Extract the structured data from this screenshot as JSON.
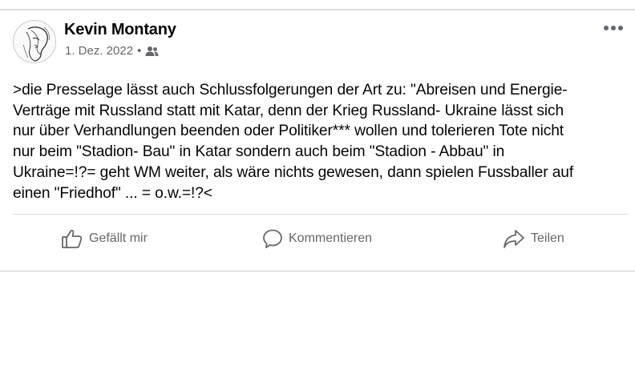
{
  "post": {
    "author": "Kevin Montany",
    "date": "1. Dez. 2022",
    "separator": "•",
    "audience_icon": "friends-icon",
    "body": ">die Presselage lässt auch Schlussfolgerungen der Art zu: \"Abreisen und Energie-\nVerträge mit Russland statt mit Katar, denn der Krieg Russland- Ukraine lässt sich\nnur über Verhandlungen beenden oder Politiker*** wollen und tolerieren Tote nicht\nnur beim \"Stadion- Bau\" in Katar sondern auch beim \"Stadion - Abbau\" in\nUkraine=!?= geht WM weiter, als wäre nichts gewesen, dann spielen Fussballer auf\neinen \"Friedhof\" ... = o.w.=!?<"
  },
  "actions": {
    "like_label": "Gefällt mir",
    "comment_label": "Kommentieren",
    "share_label": "Teilen"
  },
  "colors": {
    "text": "#050505",
    "secondary": "#65676b",
    "divider": "#dddddd"
  }
}
